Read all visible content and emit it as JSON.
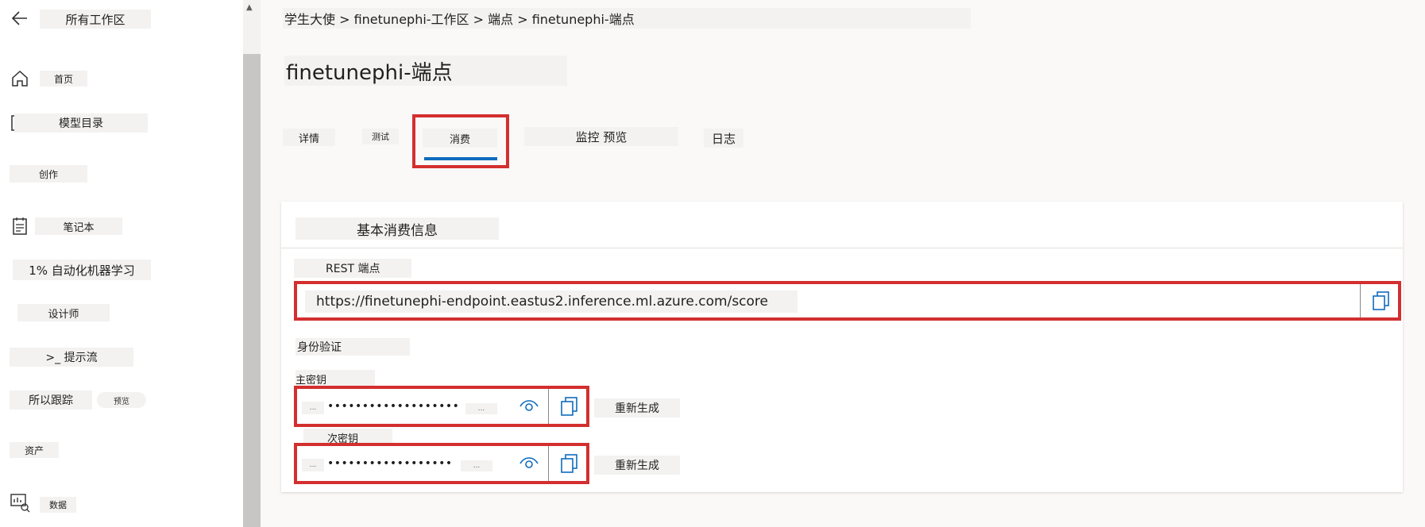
{
  "sidebar": {
    "back_label": "所有工作区",
    "items": [
      {
        "label": "首页",
        "icon": "home-icon"
      },
      {
        "label": "模型目录",
        "icon": "book-icon"
      },
      {
        "label": "创作",
        "icon": ""
      },
      {
        "label": "笔记本",
        "icon": "notebook-icon"
      },
      {
        "label": "1% 自动化机器学习",
        "icon": ""
      },
      {
        "label": "设计师",
        "icon": ""
      },
      {
        "label": ">_ 提示流",
        "icon": ""
      },
      {
        "label": "所以跟踪",
        "icon": "",
        "badge": "预览"
      },
      {
        "label": "资产",
        "icon": ""
      },
      {
        "label": "数据",
        "icon": "data-icon"
      }
    ]
  },
  "breadcrumb": "学生大使 > finetunephi-工作区 > 端点 > finetunephi-端点",
  "page_title": "finetunephi-端点",
  "tabs": [
    {
      "label": "详情"
    },
    {
      "label": "测试"
    },
    {
      "label": "消费",
      "active": true
    },
    {
      "label": "监控 预览"
    },
    {
      "label": "日志"
    }
  ],
  "consume": {
    "section_title": "基本消费信息",
    "rest_label": "REST 端点",
    "rest_url": "https://finetunephi-endpoint.eastus2.inference.ml.azure.com/score",
    "auth_label": "身份验证",
    "primary_label": "主密钥",
    "primary_value": "•••••••••••••••••••",
    "secondary_label": "次密钥",
    "secondary_value": "••••••••••••••••••",
    "regenerate_label": "重新生成",
    "ellipsis": "..."
  },
  "colors": {
    "highlight": "#d32f2f",
    "accent": "#0f6cbd"
  }
}
